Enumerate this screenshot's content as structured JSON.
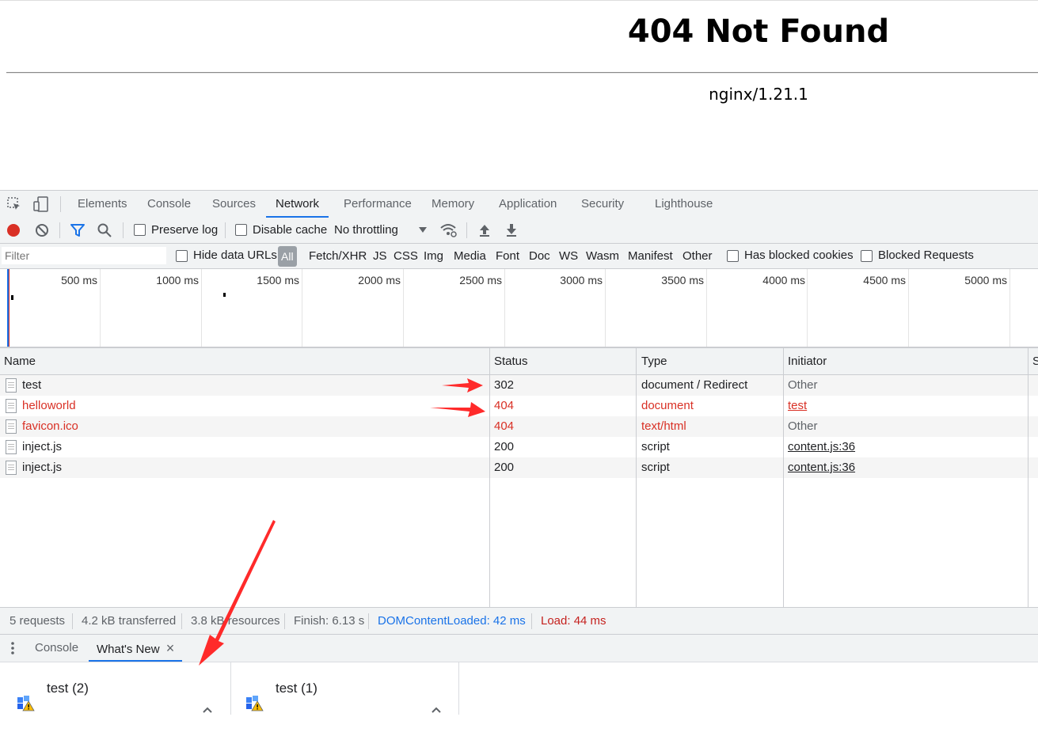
{
  "page": {
    "heading": "404 Not Found",
    "server": "nginx/1.21.1"
  },
  "devtools": {
    "tabs": [
      "Elements",
      "Console",
      "Sources",
      "Network",
      "Performance",
      "Memory",
      "Application",
      "Security",
      "Lighthouse"
    ],
    "active_tab": "Network",
    "toolbar": {
      "preserve_log": "Preserve log",
      "disable_cache": "Disable cache",
      "throttling": "No throttling"
    },
    "filter": {
      "placeholder": "Filter",
      "hide_data_urls": "Hide data URLs",
      "types": [
        "All",
        "Fetch/XHR",
        "JS",
        "CSS",
        "Img",
        "Media",
        "Font",
        "Doc",
        "WS",
        "Wasm",
        "Manifest",
        "Other"
      ],
      "has_blocked_cookies": "Has blocked cookies",
      "blocked_requests": "Blocked Requests"
    },
    "overview": {
      "ticks": [
        "500 ms",
        "1000 ms",
        "1500 ms",
        "2000 ms",
        "2500 ms",
        "3000 ms",
        "3500 ms",
        "4000 ms",
        "4500 ms",
        "5000 ms"
      ]
    },
    "table": {
      "headers": {
        "name": "Name",
        "status": "Status",
        "type": "Type",
        "initiator": "Initiator",
        "more": "S"
      },
      "rows": [
        {
          "name": "test",
          "status": "302",
          "type": "document / Redirect",
          "initiator": "Other"
        },
        {
          "name": "helloworld",
          "status": "404",
          "type": "document",
          "initiator": "test"
        },
        {
          "name": "favicon.ico",
          "status": "404",
          "type": "text/html",
          "initiator": "Other"
        },
        {
          "name": "inject.js",
          "status": "200",
          "type": "script",
          "initiator": "content.js:36"
        },
        {
          "name": "inject.js",
          "status": "200",
          "type": "script",
          "initiator": "content.js:36"
        }
      ]
    },
    "summary": {
      "requests": "5 requests",
      "transferred": "4.2 kB transferred",
      "resources": "3.8 kB resources",
      "finish": "Finish: 6.13 s",
      "dom_loaded": "DOMContentLoaded: 42 ms",
      "load": "Load: 44 ms"
    },
    "drawer": {
      "tabs": [
        "Console",
        "What's New"
      ],
      "close": "×"
    }
  },
  "downloads": [
    {
      "name": "test (2)"
    },
    {
      "name": "test (1)"
    }
  ],
  "colors": {
    "accent": "#1a73e8",
    "error": "#d93025",
    "annotation": "#ff2a2a"
  }
}
